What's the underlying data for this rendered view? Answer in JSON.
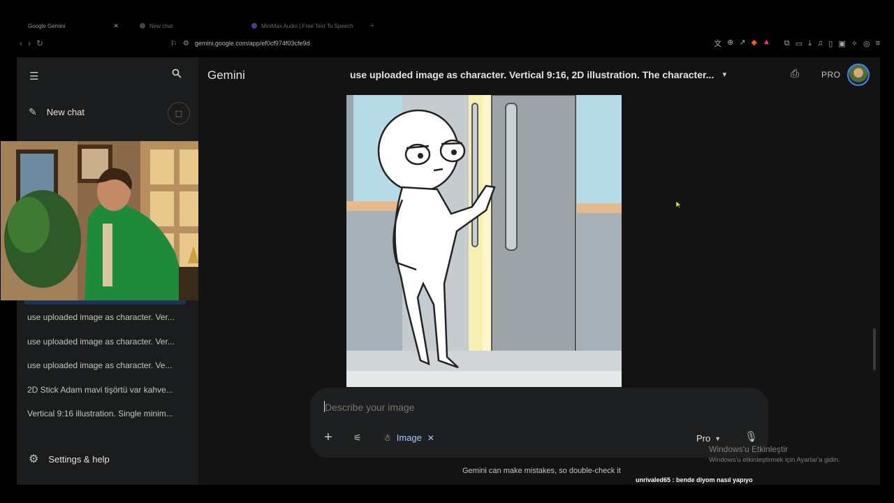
{
  "browser": {
    "tabs": [
      {
        "label": "Google Gemini",
        "active": true
      },
      {
        "label": "New chat",
        "active": false
      },
      {
        "label": "MiniMax Audio | Free Text To Speech",
        "active": false
      }
    ],
    "url": "gemini.google.com/app/ef0cf974f03cfe9d"
  },
  "sidebar": {
    "new_chat": "New chat",
    "history": [
      "use uploaded image as character. Ver...",
      "use uploaded image as character. Ver...",
      "use uploaded image as character.  Ve...",
      "2D Stick Adam mavi tişörtü var kahve...",
      "Vertical 9:16 illustration. Single minim..."
    ],
    "settings": "Settings & help"
  },
  "header": {
    "brand": "Gemini",
    "chat_title": "use uploaded image as character. Vertical 9:16, 2D illustration. The character...",
    "plan": "PRO"
  },
  "composer": {
    "placeholder": "Describe your image",
    "tool_chip": "Image",
    "model": "Pro"
  },
  "disclaimer": "Gemini can make mistakes, so double-check it",
  "windows_watermark": {
    "line1": "Windows'u Etkinleştir",
    "line2": "Windows'u etkinleştirmek için Ayarlar'a gidin."
  },
  "stream_chat": {
    "user": "unrivaled65",
    "message": "bende diyom nasıl yapıyo"
  },
  "icons": {
    "menu": "menu-icon",
    "search": "search-icon",
    "new_chat": "edit-icon",
    "temp_chat": "temporary-chat-icon",
    "settings": "gear-icon",
    "share": "share-icon",
    "add": "plus-icon",
    "tools": "tune-icon",
    "mic": "mic-icon"
  },
  "colors": {
    "accent": "#a8c7fa",
    "background": "#131314",
    "sidebar": "#1b1c1d"
  }
}
